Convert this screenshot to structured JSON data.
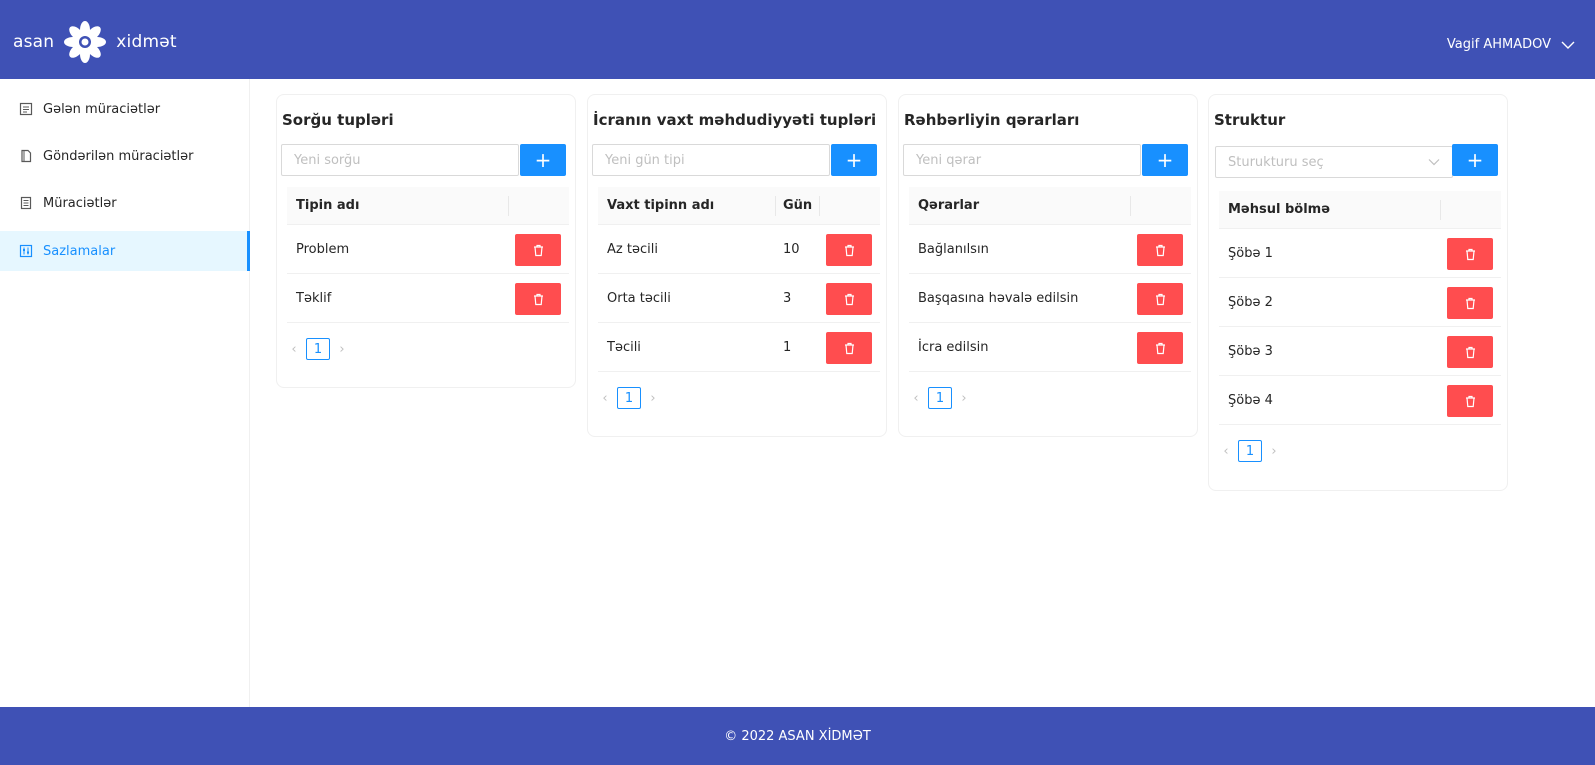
{
  "header": {
    "logo_left": "asan",
    "logo_right": "xidmət",
    "user_name": "Vagif AHMADOV"
  },
  "sidebar": {
    "items": [
      {
        "label": "Gələn müraciətlər",
        "icon": "inbox-list-icon"
      },
      {
        "label": "Göndərilən müraciətlər",
        "icon": "document-icon"
      },
      {
        "label": "Müraciətlər",
        "icon": "file-list-icon"
      },
      {
        "label": "Sazlamalar",
        "icon": "settings-sliders-icon",
        "active": true
      }
    ]
  },
  "cards": {
    "sorgu": {
      "title": "Sorğu tupləri",
      "placeholder": "Yeni sorğu",
      "column": "Tipin adı",
      "rows": [
        "Problem",
        "Təklif"
      ],
      "page": "1"
    },
    "icra": {
      "title": "İcranın vaxt məhdudiyyəti tupləri",
      "placeholder": "Yeni gün tipi",
      "column": "Vaxt tipinn adı",
      "column2": "Gün",
      "rows": [
        {
          "name": "Az təcili",
          "days": "10"
        },
        {
          "name": "Orta təcili",
          "days": "3"
        },
        {
          "name": "Təcili",
          "days": "1"
        }
      ],
      "page": "1"
    },
    "rehberlik": {
      "title": "Rəhbərliyin qərarları",
      "placeholder": "Yeni qərar",
      "column": "Qərarlar",
      "rows": [
        "Bağlanılsın",
        "Başqasına həvalə edilsin",
        "İcra edilsin"
      ],
      "page": "1"
    },
    "struktur": {
      "title": "Struktur",
      "placeholder": "Sturukturu seç",
      "column": "Məhsul bölmə",
      "rows": [
        "Şöbə 1",
        "Şöbə 2",
        "Şöbə 3",
        "Şöbə 4"
      ],
      "page": "1"
    }
  },
  "buttons": {
    "add": "+"
  },
  "footer": {
    "text": "© 2022 ASAN XİDMƏT"
  },
  "colors": {
    "header": "#3f51b5",
    "primary": "#1890ff",
    "danger": "#ff4d4f"
  }
}
